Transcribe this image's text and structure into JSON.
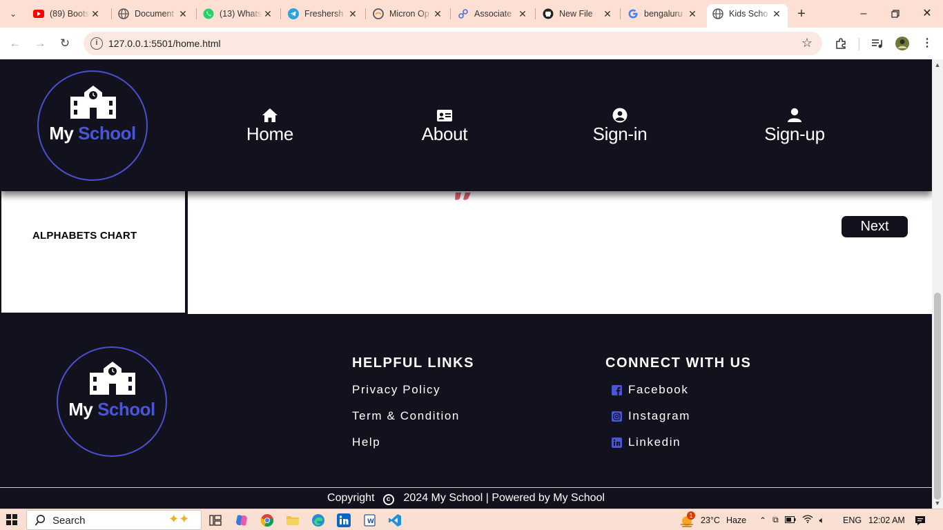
{
  "browser": {
    "tabs": [
      {
        "title": "(89) Bootstrap",
        "icon": "youtube-icon",
        "color": "#ff0000"
      },
      {
        "title": "Document",
        "icon": "globe-icon",
        "color": "#555555"
      },
      {
        "title": "(13) WhatsApp",
        "icon": "whatsapp-icon",
        "color": "#25d366"
      },
      {
        "title": "Freshersh",
        "icon": "telegram-icon",
        "color": "#2aa3e0"
      },
      {
        "title": "Micron Op",
        "icon": "micron-icon",
        "color": "#555555"
      },
      {
        "title": "Associate",
        "icon": "link-icon",
        "color": "#4a6fd8"
      },
      {
        "title": "New File",
        "icon": "github-icon",
        "color": "#222222"
      },
      {
        "title": "bengaluru",
        "icon": "google-icon",
        "color": "#4285f4"
      },
      {
        "title": "Kids Scho",
        "icon": "globe-icon",
        "color": "#555555"
      }
    ],
    "active_tab": 8,
    "url": "127.0.0.1:5501/home.html"
  },
  "header": {
    "logo": {
      "word1": "My",
      "word2": "School"
    },
    "nav": [
      {
        "label": "Home",
        "icon": "home-icon"
      },
      {
        "label": "About",
        "icon": "id-card-icon"
      },
      {
        "label": "Sign-in",
        "icon": "user-circle-icon"
      },
      {
        "label": "Sign-up",
        "icon": "user-icon"
      }
    ]
  },
  "content": {
    "sidebar_label": "ALPHABETS CHART",
    "next_label": "Next"
  },
  "footer": {
    "logo": {
      "word1": "My",
      "word2": "School"
    },
    "helpful_heading": "HELPFUL LINKS",
    "helpful_links": [
      "Privacy Policy",
      "Term & Condition",
      "Help"
    ],
    "connect_heading": "CONNECT WITH US",
    "social": [
      {
        "label": "Facebook",
        "icon": "facebook-icon"
      },
      {
        "label": "Instagram",
        "icon": "instagram-icon"
      },
      {
        "label": "Linkedin",
        "icon": "linkedin-icon"
      }
    ],
    "copyright_prefix": "Copyright",
    "copyright_year": "2024 My School",
    "separator": "|",
    "powered_by": "Powered by My School"
  },
  "colors": {
    "accent": "#4a56d6",
    "dark": "#12121e"
  },
  "taskbar": {
    "search_placeholder": "Search",
    "weather_temp": "23°C",
    "weather_text": "Haze",
    "weather_badge": "1",
    "language": "ENG",
    "time": "12:02 AM"
  }
}
